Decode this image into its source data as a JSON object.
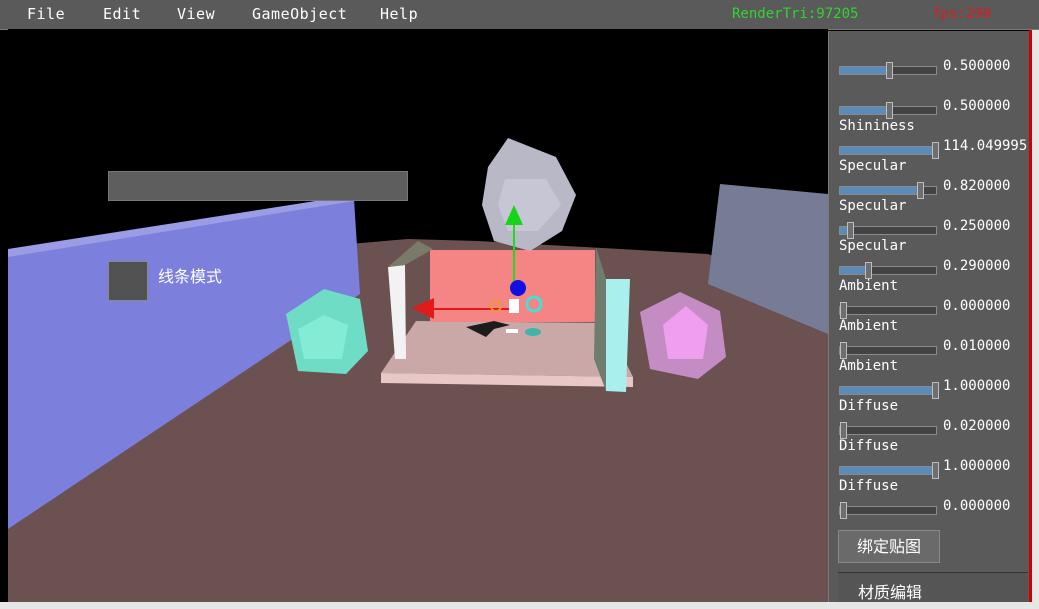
{
  "menu": {
    "items": [
      "File",
      "Edit",
      "View",
      "GameObject",
      "Help"
    ],
    "render_tri": "RenderTri:97205",
    "fps": "fps:290"
  },
  "viewport": {
    "line_mode_label": "线条模式"
  },
  "panel": {
    "rows": [
      {
        "label": "",
        "value": "0.500000",
        "fraction": 0.5
      },
      {
        "label": "",
        "value": "0.500000",
        "fraction": 0.5
      },
      {
        "label": "Shininess",
        "value": "114.049995",
        "fraction": 0.98
      },
      {
        "label": "Specular",
        "value": "0.820000",
        "fraction": 0.82
      },
      {
        "label": "Specular",
        "value": "0.250000",
        "fraction": 0.1
      },
      {
        "label": "Specular",
        "value": "0.290000",
        "fraction": 0.29
      },
      {
        "label": "Ambient",
        "value": "0.000000",
        "fraction": 0.0
      },
      {
        "label": "Ambient",
        "value": "0.010000",
        "fraction": 0.01
      },
      {
        "label": "Ambient",
        "value": "1.000000",
        "fraction": 1.0
      },
      {
        "label": "Diffuse",
        "value": "0.020000",
        "fraction": 0.02
      },
      {
        "label": "Diffuse",
        "value": "1.000000",
        "fraction": 1.0
      },
      {
        "label": "Diffuse",
        "value": "0.000000",
        "fraction": 0.0
      }
    ],
    "bind_texture_label": "绑定贴图",
    "material_edit_label": "材质编辑"
  },
  "colors": {
    "menubar": "#5a5a5a",
    "panel": "#5a5a5a",
    "slider_fill": "#5b8bb8",
    "render_tri": "#2ed62e",
    "fps": "#d62020"
  }
}
